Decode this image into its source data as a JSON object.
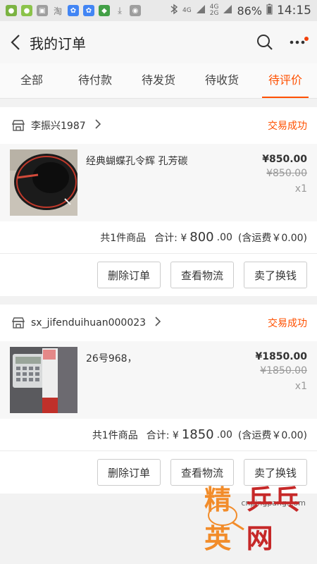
{
  "status_bar": {
    "network": "4G",
    "network2": "4G",
    "network_sub": "2G",
    "battery": "86%",
    "time": "14:15"
  },
  "header": {
    "title": "我的订单"
  },
  "tabs": [
    {
      "label": "全部"
    },
    {
      "label": "待付款"
    },
    {
      "label": "待发货"
    },
    {
      "label": "待收货"
    },
    {
      "label": "待评价",
      "active": true
    }
  ],
  "orders": [
    {
      "shop": "李振兴1987",
      "status": "交易成功",
      "item_name": "经典蝴蝶孔令辉 孔芳碳",
      "price": "¥850.00",
      "orig_price": "¥850.00",
      "qty": "x1",
      "summary_count": "共1件商品",
      "summary_label": "合计: ¥",
      "summary_total": "800",
      "summary_decimal": ".00",
      "summary_shipping": "(含运费￥0.00)",
      "actions": [
        "删除订单",
        "查看物流",
        "卖了换钱"
      ]
    },
    {
      "shop": "sx_jifenduihuan000023",
      "status": "交易成功",
      "item_name": "26号968，",
      "price": "¥1850.00",
      "orig_price": "¥1850.00",
      "qty": "x1",
      "summary_count": "共1件商品",
      "summary_label": "合计: ¥",
      "summary_total": "1850",
      "summary_decimal": ".00",
      "summary_shipping": "(含运费￥0.00)",
      "actions": [
        "删除订单",
        "查看物流",
        "卖了换钱"
      ]
    }
  ],
  "watermark": {
    "url": "cnpingpang.com",
    "text1": "精英",
    "text2": "乒乓网"
  },
  "colors": {
    "accent": "#ff5000"
  }
}
